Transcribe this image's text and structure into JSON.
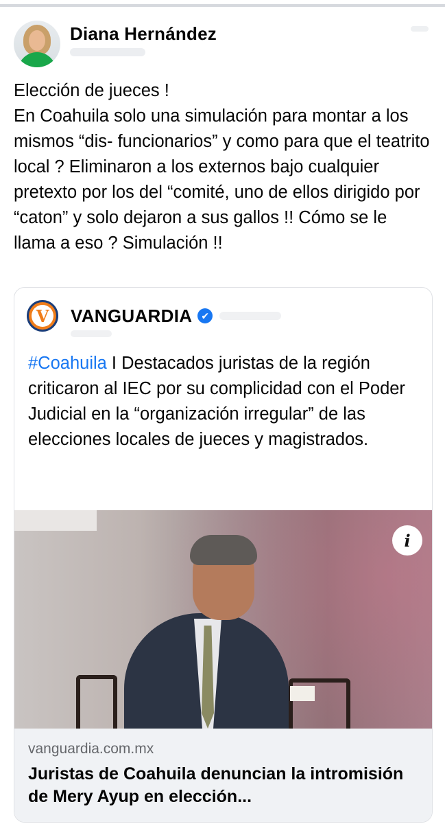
{
  "post": {
    "author_name": "Diana Hernández",
    "text": "Elección de jueces !\nEn Coahuila solo una simulación para montar a los mismos “dis- funcionarios” y como para que el teatrito local ? Eliminaron a los externos bajo cualquier pretexto por los del “comité, uno de ellos dirigido por “caton” y solo dejaron a sus gallos !! Cómo se le llama a eso ? Simulación !!"
  },
  "shared_post": {
    "logo_letter": "V",
    "page_name": "VANGUARDIA",
    "verified_icon": "✔",
    "hashtag": "#Coahuila",
    "body": " I Destacados juristas de la región criticaron al IEC por su complicidad con el Poder Judicial en la “organización irregular” de las elecciones locales de jueces y magistrados."
  },
  "link_preview": {
    "info_icon": "i",
    "domain": "vanguardia.com.mx",
    "title": "Juristas de Coahuila denuncian la intromisión de Mery Ayup en elección..."
  },
  "colors": {
    "accent_blue": "#1877f2",
    "brand_orange": "#f07d1a",
    "brand_navy": "#1b3e7a",
    "link_footer_bg": "#f0f2f5"
  }
}
